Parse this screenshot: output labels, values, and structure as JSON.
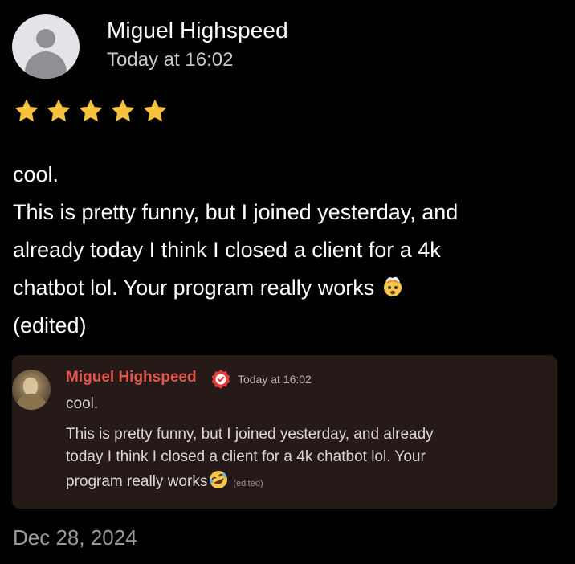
{
  "review": {
    "author": "Miguel Highspeed",
    "time": "Today at 16:02",
    "rating": 5,
    "lines": [
      "cool.",
      "This is pretty funny, but I joined yesterday, and",
      "already today I think I closed a client for a 4k",
      "chatbot lol. Your program really works",
      "(edited)"
    ],
    "emoji": "exploding-head-emoji",
    "date": "Dec 28, 2024"
  },
  "embed": {
    "author": "Miguel Highspeed",
    "time": "Today at 16:02",
    "lines": [
      "cool.",
      "This is pretty funny, but I joined yesterday, and already",
      "today I think I closed a client for a 4k chatbot lol. Your",
      "program really works"
    ],
    "edited": "(edited)",
    "emoji": "rolling-laughing-emoji",
    "badge_icon": "verified-badge-icon"
  },
  "colors": {
    "background": "#000000",
    "star": "#f5c33b",
    "embed_background": "#261a18",
    "embed_name": "#e0564c",
    "date": "#9a9a9a"
  }
}
